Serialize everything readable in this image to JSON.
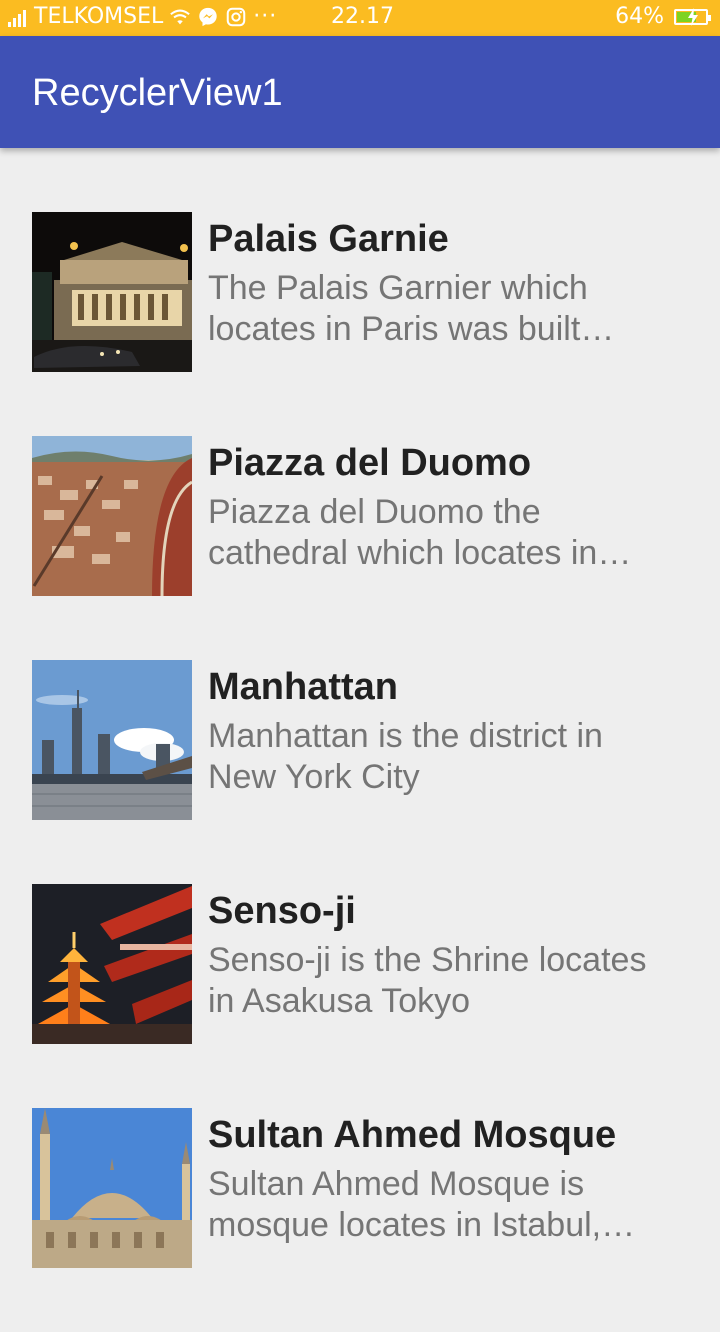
{
  "status_bar": {
    "carrier": "TELKOMSEL",
    "time": "22.17",
    "battery_percent": "64%",
    "battery_level": 0.64,
    "icons": [
      "signal-icon",
      "wifi-icon",
      "messenger-icon",
      "instagram-icon",
      "more-icon",
      "battery-charging-icon"
    ],
    "more": "···"
  },
  "app_bar": {
    "title": "RecyclerView1",
    "color": "#3f51b5"
  },
  "items": [
    {
      "title": "Palais Garnie",
      "description": "The Palais Garnier which locates in Paris was built…"
    },
    {
      "title": "Piazza del Duomo",
      "description": "Piazza del Duomo the cathedral which locates in…"
    },
    {
      "title": "Manhattan",
      "description": "Manhattan is the district in New York City"
    },
    {
      "title": "Senso-ji",
      "description": "Senso-ji is the Shrine locates in Asakusa Tokyo"
    },
    {
      "title": "Sultan Ahmed Mosque",
      "description": "Sultan Ahmed Mosque is mosque locates in Istabul,…"
    }
  ]
}
